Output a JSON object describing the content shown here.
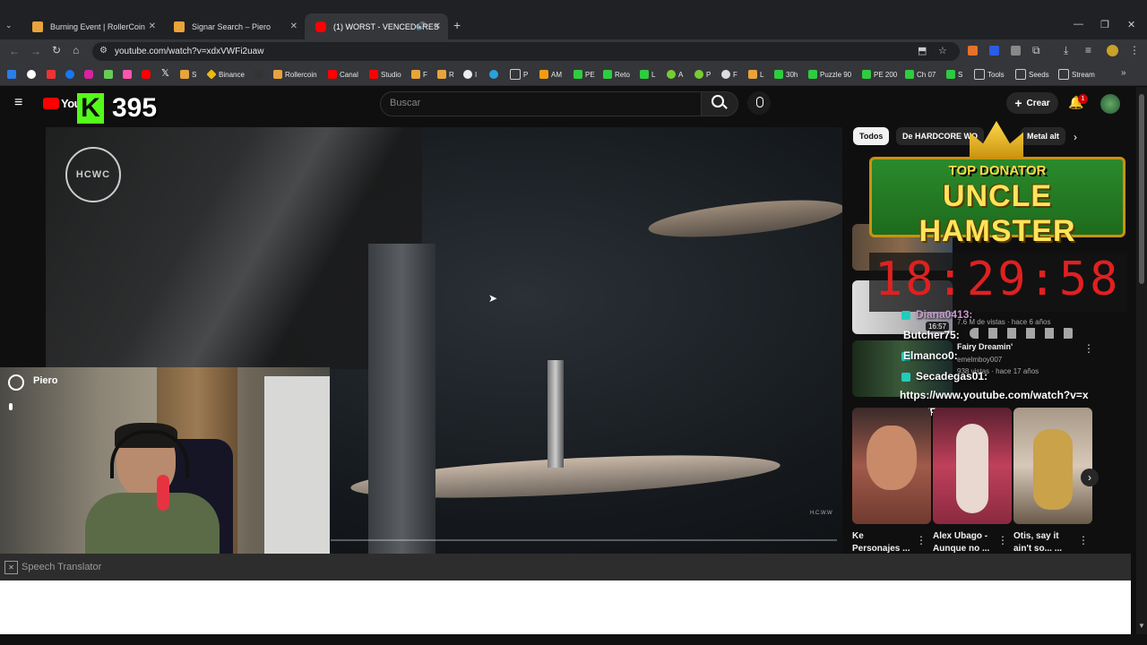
{
  "browser": {
    "tabs": [
      {
        "title": "Burning Event | RollerCoin",
        "active": false
      },
      {
        "title": "Signar Search – Piero",
        "active": false
      },
      {
        "title": "(1) WORST - VENCEDORES",
        "active": true
      }
    ],
    "url": "youtube.com/watch?v=xdxVWFi2uaw",
    "bookmarks": [
      "S",
      "Binance",
      "Rollercoin",
      "Canal",
      "Studio",
      "F",
      "R",
      "I",
      "P",
      "AM",
      "PE",
      "Reto",
      "L",
      "A",
      "P",
      "F",
      "L",
      "30h",
      "Puzzle 90",
      "PE 200",
      "Ch 07",
      "S",
      "Tools",
      "Seeds",
      "Stream"
    ]
  },
  "youtube": {
    "logo_text": "You",
    "search_placeholder": "Buscar",
    "create_label": "Crear",
    "notification_count": "1",
    "chips": [
      "Todos",
      "De HARDCORE WO",
      "Metal alt"
    ],
    "cards": [
      {
        "title": "Ke Personajes ..."
      },
      {
        "title": "Alex Ubago - Aunque no ..."
      },
      {
        "title": "Otis, say it ain't so... ..."
      }
    ],
    "list_items": [
      {
        "views": "7.6 M de vistas · hace 6 años",
        "duration": "16:57"
      },
      {
        "channel": "Fairy Dreamin'",
        "sub": "emelmboy007",
        "views": "938 vistas · hace 17 años"
      }
    ]
  },
  "overlay": {
    "counter": "395",
    "counter_logo": "K",
    "top_donator_label": "TOP DONATOR",
    "top_donator_name": "UNCLE HAMSTER",
    "timer": "18:29:58",
    "chat": [
      {
        "user": "Diana0413",
        "text": ":"
      },
      {
        "user": "Butcher75",
        "text": ":"
      },
      {
        "user": "Elmanco0",
        "text": ":"
      },
      {
        "user": "Secadegas01",
        "text": ":"
      }
    ],
    "chat_link": "https://www.youtube.com/watch?v=xdxVWFi2uaw",
    "webcam_name": "Piero",
    "video_watermark": "HCWC",
    "video_corner_text": "H.C.W.W"
  },
  "translator": {
    "label": "Speech Translator"
  },
  "colors": {
    "accent": "#ff0000",
    "chat_name": "#ffffff",
    "timer": "#e02020",
    "kick_green": "#53fc18"
  }
}
